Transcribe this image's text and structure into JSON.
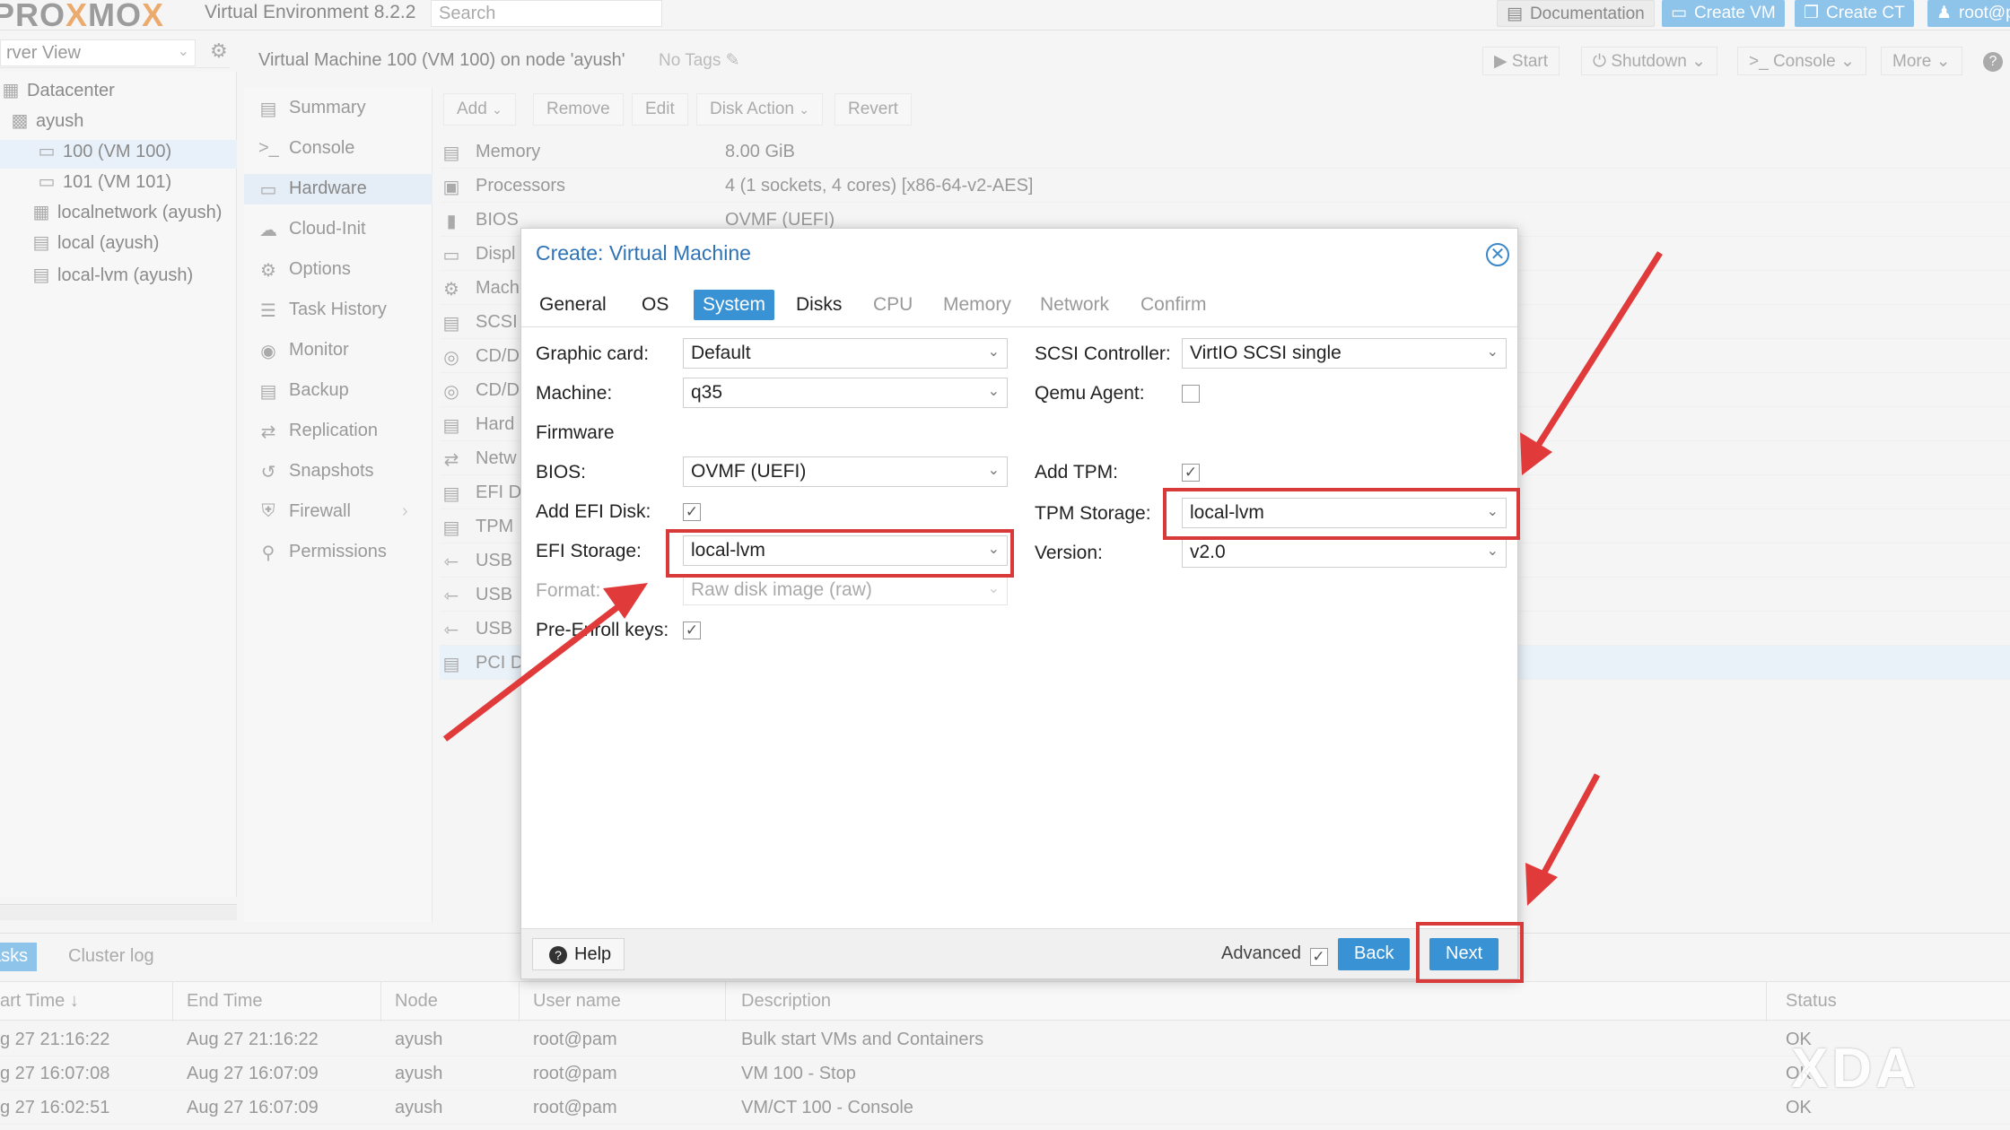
{
  "topbar": {
    "logo_a": "PRO",
    "logo_x": "X",
    "logo_b": "MO",
    "logo_x2": "X",
    "version": "Virtual Environment 8.2.2",
    "search_placeholder": "Search",
    "documentation": "Documentation",
    "create_vm": "Create VM",
    "create_ct": "Create CT",
    "user": "root@p"
  },
  "tree": {
    "view": "rver View",
    "nodes": [
      "Datacenter",
      "ayush",
      "100 (VM 100)",
      "101 (VM 101)",
      "localnetwork (ayush)",
      "local (ayush)",
      "local-lvm (ayush)"
    ]
  },
  "content_header": {
    "title": "Virtual Machine 100 (VM 100) on node 'ayush'",
    "no_tags": "No Tags",
    "start": "Start",
    "shutdown": "Shutdown",
    "console": "Console",
    "more": "More"
  },
  "config_menu": [
    "Summary",
    "Console",
    "Hardware",
    "Cloud-Init",
    "Options",
    "Task History",
    "Monitor",
    "Backup",
    "Replication",
    "Snapshots",
    "Firewall",
    "Permissions"
  ],
  "hardware": {
    "toolbar": [
      "Add",
      "Remove",
      "Edit",
      "Disk Action",
      "Revert"
    ],
    "rows": [
      {
        "name": "Memory",
        "value": "8.00 GiB"
      },
      {
        "name": "Processors",
        "value": "4 (1 sockets, 4 cores) [x86-64-v2-AES]"
      },
      {
        "name": "BIOS",
        "value": "OVMF (UEFI)"
      },
      {
        "name": "Displ",
        "value": ""
      },
      {
        "name": "Mach",
        "value": ""
      },
      {
        "name": "SCSI",
        "value": ""
      },
      {
        "name": "CD/D",
        "value": ""
      },
      {
        "name": "CD/D",
        "value": ""
      },
      {
        "name": "Hard",
        "value": ""
      },
      {
        "name": "Netw",
        "value": ""
      },
      {
        "name": "EFI D",
        "value": ""
      },
      {
        "name": "TPM",
        "value": ""
      },
      {
        "name": "USB",
        "value": ""
      },
      {
        "name": "USB",
        "value": ""
      },
      {
        "name": "USB",
        "value": ""
      },
      {
        "name": "PCI D",
        "value": ""
      }
    ]
  },
  "modal": {
    "title": "Create: Virtual Machine",
    "tabs": [
      "General",
      "OS",
      "System",
      "Disks",
      "CPU",
      "Memory",
      "Network",
      "Confirm"
    ],
    "active_tab": "System",
    "fields": {
      "graphic_card_label": "Graphic card:",
      "graphic_card_value": "Default",
      "machine_label": "Machine:",
      "machine_value": "q35",
      "firmware_heading": "Firmware",
      "bios_label": "BIOS:",
      "bios_value": "OVMF (UEFI)",
      "add_efi_label": "Add EFI Disk:",
      "add_efi_checked": true,
      "efi_storage_label": "EFI Storage:",
      "efi_storage_value": "local-lvm",
      "format_label": "Format:",
      "format_value": "Raw disk image (raw)",
      "pre_enroll_label": "Pre-Enroll keys:",
      "pre_enroll_checked": true,
      "scsi_controller_label": "SCSI Controller:",
      "scsi_controller_value": "VirtIO SCSI single",
      "qemu_agent_label": "Qemu Agent:",
      "qemu_agent_checked": false,
      "add_tpm_label": "Add TPM:",
      "add_tpm_checked": true,
      "tpm_storage_label": "TPM Storage:",
      "tpm_storage_value": "local-lvm",
      "version_label": "Version:",
      "version_value": "v2.0"
    },
    "footer": {
      "help": "Help",
      "advanced": "Advanced",
      "advanced_checked": true,
      "back": "Back",
      "next": "Next"
    }
  },
  "tasks": {
    "tabs": [
      "asks",
      "Cluster log"
    ],
    "columns": [
      "art Time",
      "End Time",
      "Node",
      "User name",
      "Description",
      "Status"
    ],
    "rows": [
      {
        "start": "g 27 21:16:22",
        "end": "Aug 27 21:16:22",
        "node": "ayush",
        "user": "root@pam",
        "desc": "Bulk start VMs and Containers",
        "status": "OK"
      },
      {
        "start": "g 27 16:07:08",
        "end": "Aug 27 16:07:09",
        "node": "ayush",
        "user": "root@pam",
        "desc": "VM 100 - Stop",
        "status": "OK"
      },
      {
        "start": "g 27 16:02:51",
        "end": "Aug 27 16:07:09",
        "node": "ayush",
        "user": "root@pam",
        "desc": "VM/CT 100 - Console",
        "status": "OK"
      }
    ]
  },
  "watermark": "XDA",
  "colors": {
    "accent": "#3892d4",
    "title_blue": "#2e73b5",
    "annotation_red": "#d83a3a"
  }
}
